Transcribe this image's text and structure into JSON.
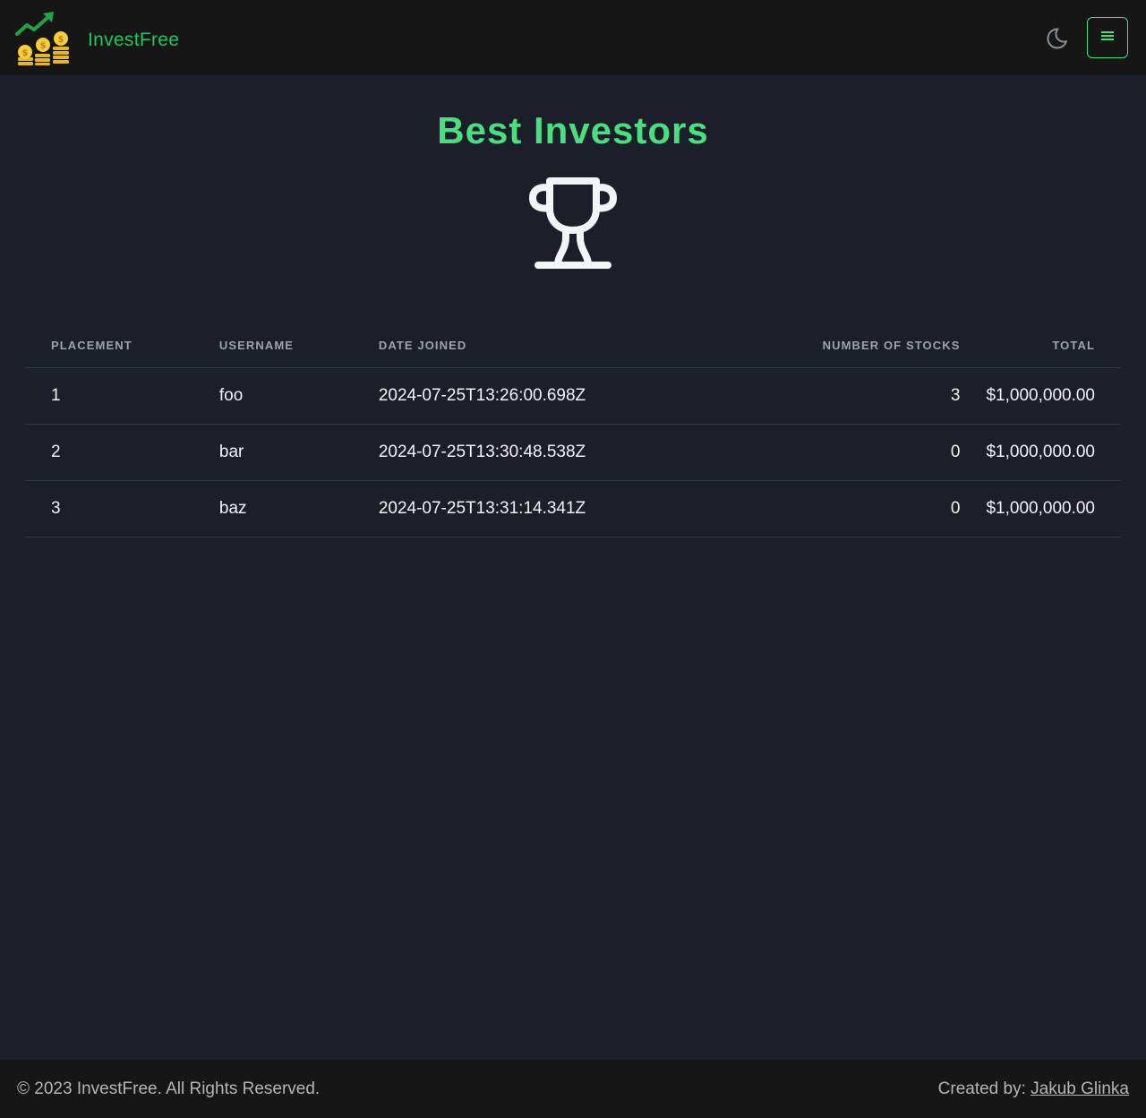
{
  "navbar": {
    "brand_name": "InvestFree",
    "theme_toggle_icon": "moon-icon",
    "menu_icon": "hamburger-menu-icon",
    "accent_color": "#22c55e"
  },
  "main": {
    "title": "Best Investors",
    "trophy_icon": "trophy-icon",
    "table": {
      "headers": {
        "placement": "PLACEMENT",
        "username": "USERNAME",
        "date_joined": "DATE JOINED",
        "number_of_stocks": "NUMBER OF STOCKS",
        "total": "TOTAL"
      },
      "rows": [
        {
          "placement": "1",
          "username": "foo",
          "date_joined": "2024-07-25T13:26:00.698Z",
          "number_of_stocks": "3",
          "total": "$1,000,000.00"
        },
        {
          "placement": "2",
          "username": "bar",
          "date_joined": "2024-07-25T13:30:48.538Z",
          "number_of_stocks": "0",
          "total": "$1,000,000.00"
        },
        {
          "placement": "3",
          "username": "baz",
          "date_joined": "2024-07-25T13:31:14.341Z",
          "number_of_stocks": "0",
          "total": "$1,000,000.00"
        }
      ]
    }
  },
  "footer": {
    "copyright": "© 2023 InvestFree. All Rights Reserved.",
    "created_by_label": "Created by: ",
    "author_name": "Jakub Glinka"
  }
}
